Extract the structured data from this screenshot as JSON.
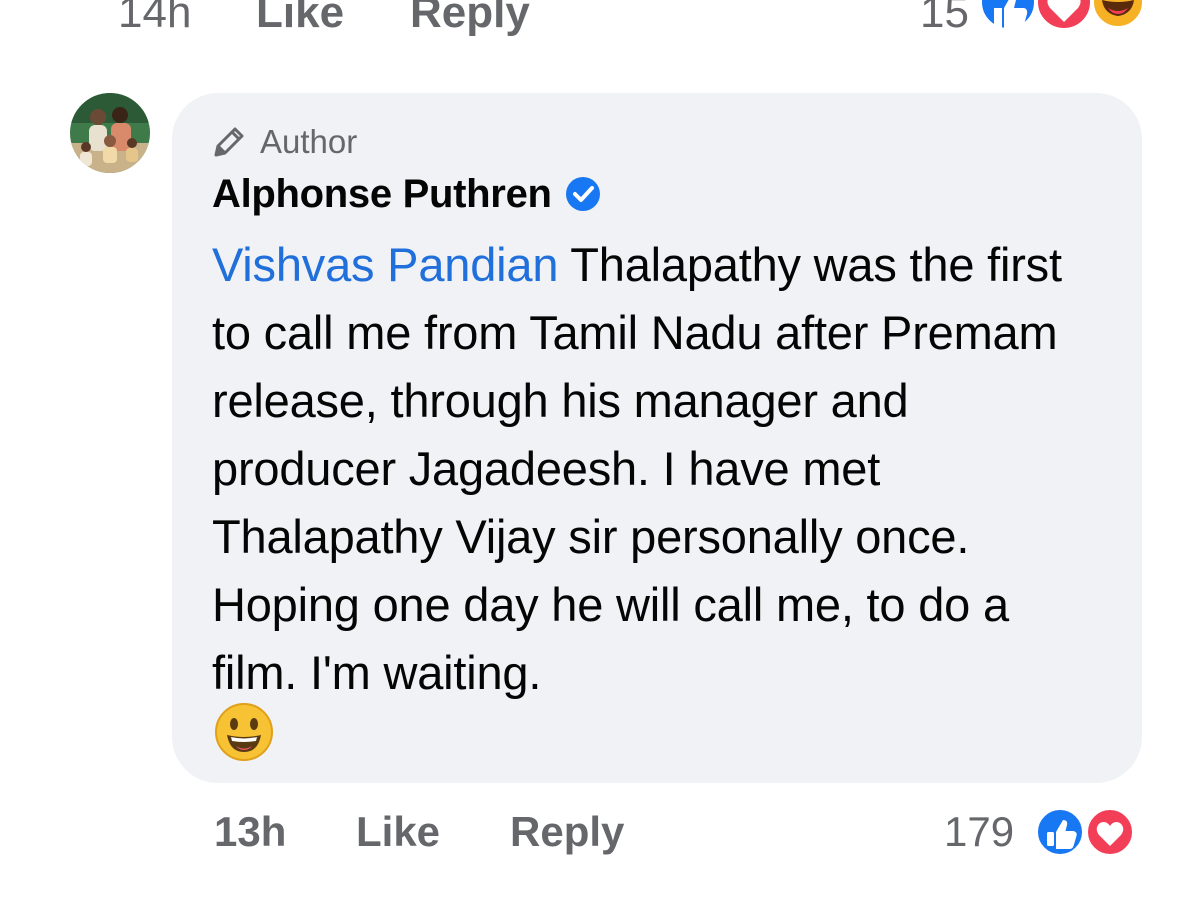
{
  "previous_comment": {
    "time": "14h",
    "like_label": "Like",
    "reply_label": "Reply",
    "reaction_count": "15",
    "reactions": [
      "like-icon",
      "love-icon",
      "haha-icon"
    ]
  },
  "comment": {
    "badge": {
      "icon": "pen-icon",
      "label": "Author"
    },
    "author_name": "Alphonse Puthren",
    "verified_icon": "verified-badge-icon",
    "mention": "Vishvas Pandian",
    "text": " Thalapathy was the first to call me from Tamil Nadu after Premam release, through his manager and producer Jagadeesh. I have met Thalapathy Vijay sir personally once. Hoping one day he will call me, to do a film. I'm waiting.",
    "emoji": "smiley-emoji",
    "time": "13h",
    "like_label": "Like",
    "reply_label": "Reply",
    "reaction_count": "179",
    "reactions": [
      "like-icon",
      "love-icon"
    ]
  },
  "colors": {
    "bubble_bg": "#f0f2f5",
    "mention": "#216fdb",
    "secondary_text": "#65676b",
    "like_blue": "#1877f2",
    "love_red": "#f33e58",
    "verified_blue": "#1877f2"
  }
}
